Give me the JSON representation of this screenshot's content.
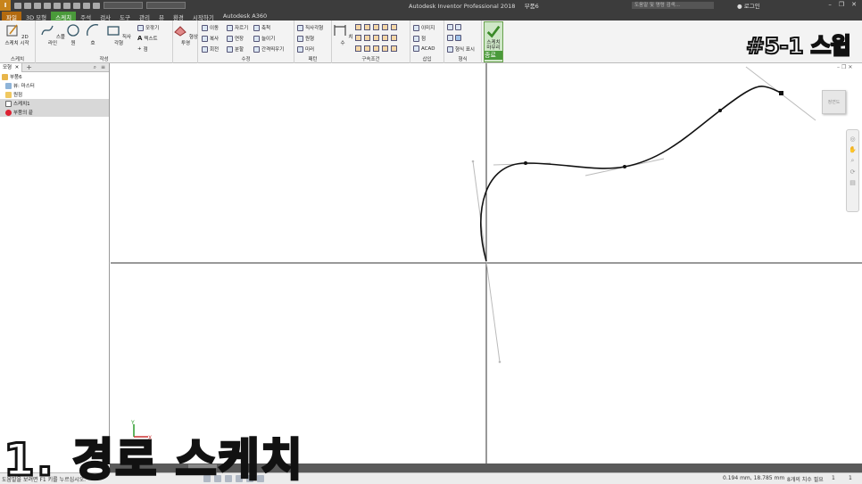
{
  "window": {
    "title": "Autodesk Inventor Professional 2018",
    "document": "부품6",
    "search_placeholder": "도움말 및 명령 검색...",
    "login_label": "로그인"
  },
  "tabs": [
    {
      "label": "파일"
    },
    {
      "label": "3D 모형"
    },
    {
      "label": "스케치"
    },
    {
      "label": "주석"
    },
    {
      "label": "검사"
    },
    {
      "label": "도구"
    },
    {
      "label": "관리"
    },
    {
      "label": "뷰"
    },
    {
      "label": "환경"
    },
    {
      "label": "시작하기"
    },
    {
      "label": "Autodesk A360"
    }
  ],
  "ribbon": {
    "sketch_group_label": "스케치",
    "start_2d_sketch": "2D 스케치 시작",
    "create": {
      "label": "작성",
      "spline": "스플라인",
      "circle": "원",
      "arc": "호",
      "rectangle": "직사각형",
      "fillet": "모깎기",
      "text": "텍스트",
      "point": "점"
    },
    "shape_project": "형상 투영",
    "modify": {
      "label": "수정",
      "move": "이동",
      "copy": "복사",
      "rotate": "회전",
      "trim": "자르기",
      "extend": "연장",
      "split": "분할",
      "scale": "축척",
      "stretch": "늘이기",
      "offset": "간격띄우기"
    },
    "pattern": {
      "label": "패턴",
      "rectangular": "직사각형",
      "circular": "원형",
      "mirror": "미러"
    },
    "dimension": "치수",
    "constrain_label": "구속조건",
    "insert": {
      "label": "삽입",
      "image": "이미지",
      "points": "점",
      "acad": "ACAD"
    },
    "format": {
      "label": "형식",
      "format_display": "형식 표시"
    },
    "finish": {
      "label": "종료",
      "button": "스케치 마무리"
    }
  },
  "browser": {
    "tab_label": "모형",
    "tree": [
      {
        "label": "부품6"
      },
      {
        "label": "뷰: 마스터"
      },
      {
        "label": "원점"
      },
      {
        "label": "스케치1"
      },
      {
        "label": "부품의 끝"
      }
    ]
  },
  "viewcube_label": "정면도",
  "overlay": {
    "title": "#5-1 스윕",
    "caption": "1. 경로 스케치"
  },
  "status": {
    "message": "도움말을 보려면 F1 키를 누르십시오.",
    "coordinates": "0.194 mm, 18.785 mm",
    "dims_needed": "8개의 치수 필요",
    "count1": "1",
    "count2": "1"
  },
  "colors": {
    "file_tab": "#b36a0f",
    "active_tab": "#4a9a3a",
    "axis_line": "#333333",
    "spline": "#111111"
  }
}
